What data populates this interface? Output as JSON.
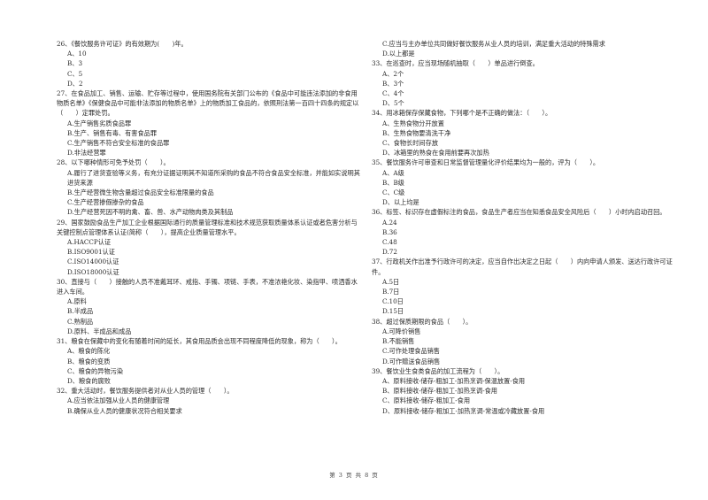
{
  "left_column": [
    {
      "stem": "26、《餐饮服务许可证》的有效期为(　　)年。",
      "options": [
        "A、10",
        "B、3",
        "C、5",
        "D、2"
      ]
    },
    {
      "stem": "27、在食品加工、销售、运输、贮存等过程中，使用国务院有关部门公布的《食品中可能违法添加的非食用物质名单》《保健食品中可能非法添加的物质名单》上的物质加工食品的，依照刑法第一百四十四条的规定以（　　）定罪处罚。",
      "options": [
        "A.生产销售劣质食品罪",
        "B.生产、销售有毒、有害食品罪",
        "C.生产销售不符合安全标准的食品罪",
        "D.非法经营罪"
      ]
    },
    {
      "stem": "28、以下哪种情形可免予处罚（　　）。",
      "options": [
        "A.履行了进货查验等义务，有充分证据证明其不知道所采购的食品不符合食品安全标准，并能如实说明其进货来源",
        "B.生产经营微生物含量超过食品安全标准限量的食品",
        "C.生产经营掺假掺杂的食品",
        "D.生产经营死因不明的禽、畜、兽、水产动物肉类及其制品"
      ]
    },
    {
      "stem": "29、国家鼓励食品生产加工企业根据国际通行的质量管理标准和技术规范获取质量体系认证或者危害分析与关键控制点管理体系认证(简称（　　），提高企业质量管理水平。",
      "options": [
        "A.HACCP认证",
        "B.ISO9001认证",
        "C.ISO14000认证",
        "D.ISO18000认证"
      ]
    },
    {
      "stem": "30、直接与（　　）接触的人员不准戴耳环、戒指、手镯、项链、手表，不准浓艳化妆、染指甲、喷洒香水进入车间。",
      "options": [
        "A.原料",
        "B.半成品",
        "C.熟制品",
        "D.原料、半成品和成品"
      ]
    },
    {
      "stem": "31、粮食在保藏中的变化有随着时间的延长，其食用品质会出现不同程度降低的现象，称为（　　）。",
      "options": [
        "A、粮食的陈化",
        "B、粮食的变质",
        "C、粮食的异物污染",
        "D、粮食的腐败"
      ]
    },
    {
      "stem": "32、重大活动时，餐饮服务提供者对从业人员的管理（　　）。",
      "options": [
        "A.应当依法加强从业人员的健康管理",
        "B.确保从业人员的健康状况符合相关要求"
      ]
    }
  ],
  "right_column": [
    {
      "stem": "",
      "options": [
        "C.应当与主办单位共同做好餐饮服务从业人员的培训，满足重大活动的特殊需求",
        "D.以上都是"
      ]
    },
    {
      "stem": "33、在巡查时，应当现场随机抽取（　　）单品进行倒查。",
      "options": [
        "A、2个",
        "B、3个",
        "C、4个",
        "D、5个"
      ]
    },
    {
      "stem": "34、用冰箱保存保藏食物，下列哪个是不正确的做法：（　　）。",
      "options": [
        "A、生熟食物分开放置",
        "B、生熟食物要清洗干净",
        "C、食物长时间存放",
        "D、冰箱里的熟食在食用前要再次加热"
      ]
    },
    {
      "stem": "35、餐饮服务许可审查和日常监督管理量化评价结果均为一般的，评为（　　）。",
      "options": [
        "A、A级",
        "B、B级",
        "C、C级",
        "D、以上均是"
      ]
    },
    {
      "stem": "36、标签、标识存在虚假标注的食品，食品生产者应当在知悉食品安全风险后（　　）小时内启动召回。",
      "options": [
        "A.24",
        "B.36",
        "C.48",
        "D.72"
      ]
    },
    {
      "stem": "37、行政机关作出准予行政许可的决定，应当自作出决定之日起（　　）内向申请人颁发、送达行政许可证件。",
      "options": [
        "A.5日",
        "B.7日",
        "C.10日",
        "D.15日"
      ]
    },
    {
      "stem": "38、超过保质期限的食品（　　）。",
      "options": [
        "A.可降价销售",
        "B.不能销售",
        "C.可作处理食品销售",
        "D.可作赠送食品销售"
      ]
    },
    {
      "stem": "39、餐饮业生食类食品的加工流程为（　　）。",
      "options": [
        "A、原料接收-储存-粗加工-加热烹调-保温放置-食用",
        "B、原料接收-储存-粗加工-加热烹调-食用",
        "C、原料接收-储存-粗加工-食用",
        "D、原料接收-储存-粗加工-加热烹调-常温或冷藏放置-食用"
      ]
    }
  ],
  "footer": {
    "page_label": "第 3 页 共 8 页"
  }
}
